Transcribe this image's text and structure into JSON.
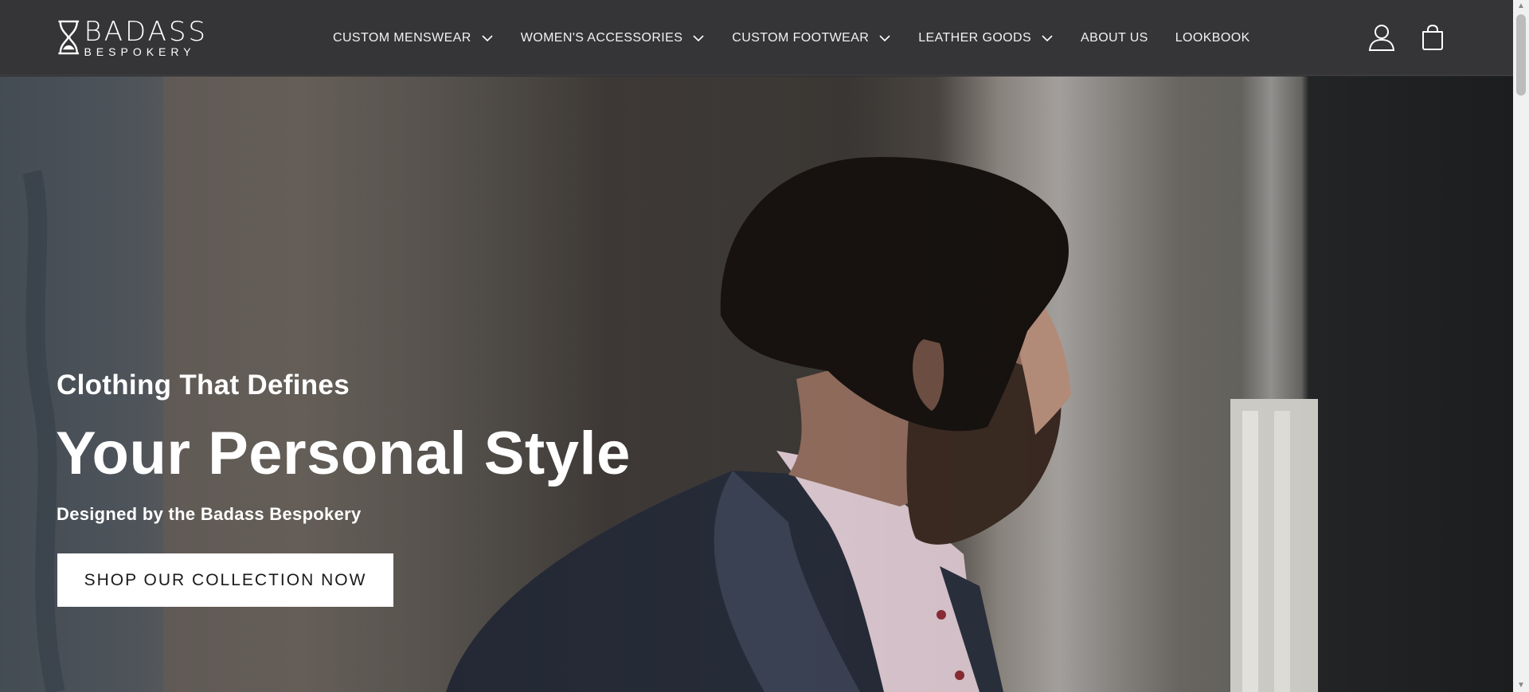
{
  "brand": {
    "name": "BADASS",
    "tagline": "BESPOKERY"
  },
  "nav": {
    "items": [
      {
        "label": "CUSTOM MENSWEAR",
        "has_dropdown": true
      },
      {
        "label": "WOMEN'S ACCESSORIES",
        "has_dropdown": true
      },
      {
        "label": "CUSTOM FOOTWEAR",
        "has_dropdown": true
      },
      {
        "label": "LEATHER GOODS",
        "has_dropdown": true
      },
      {
        "label": "ABOUT US",
        "has_dropdown": false
      },
      {
        "label": "LOOKBOOK",
        "has_dropdown": false
      }
    ]
  },
  "header_icons": {
    "account": "account-icon",
    "cart": "cart-icon"
  },
  "hero": {
    "subheading": "Clothing That Defines",
    "heading": "Your Personal Style",
    "tagline": "Designed by the Badass Bespokery",
    "cta_label": "SHOP OUR COLLECTION NOW"
  },
  "colors": {
    "header_bg": "#353537",
    "text": "#ffffff",
    "button_bg": "#ffffff",
    "button_text": "#1a1a1a"
  }
}
